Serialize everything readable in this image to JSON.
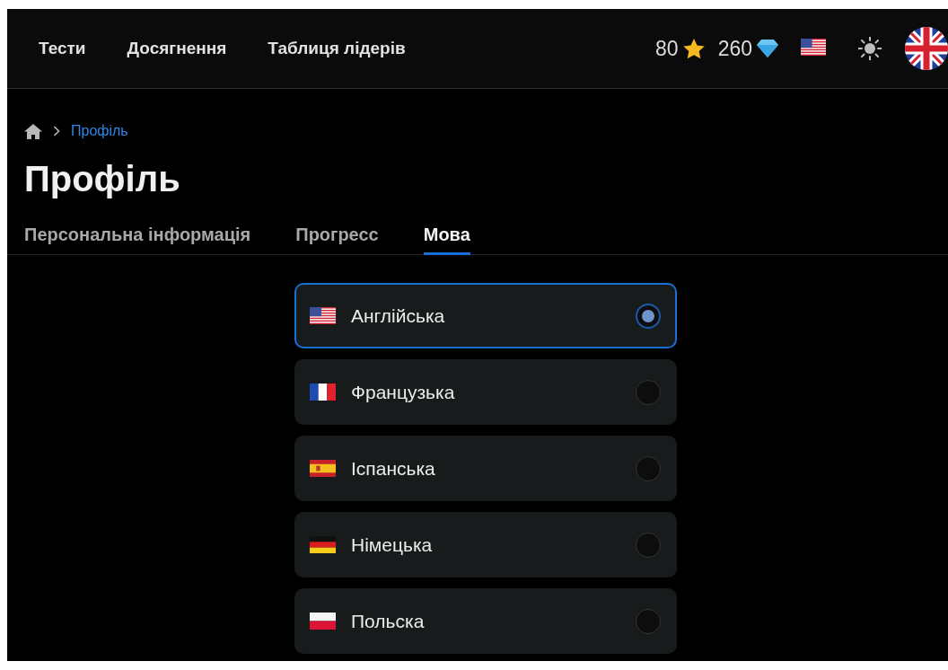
{
  "nav": {
    "links": [
      {
        "label": "Тести"
      },
      {
        "label": "Досягнення"
      },
      {
        "label": "Таблиця лідерів"
      }
    ],
    "stars": "80",
    "gems": "260",
    "language_flag": {
      "kind": "us"
    },
    "avatar": {
      "kind": "gb"
    }
  },
  "breadcrumb": {
    "current": "Профіль"
  },
  "title": "Профіль",
  "tabs": [
    {
      "label": "Персональна інформація",
      "selected": false
    },
    {
      "label": "Прогресс",
      "selected": false
    },
    {
      "label": "Мова",
      "selected": true
    }
  ],
  "languages": [
    {
      "label": "Англійська",
      "kind": "us",
      "selected": true
    },
    {
      "label": "Французька",
      "kind": "fr",
      "selected": false
    },
    {
      "label": "Іспанська",
      "kind": "es",
      "selected": false
    },
    {
      "label": "Німецька",
      "kind": "de",
      "selected": false
    },
    {
      "label": "Польска",
      "kind": "pl",
      "selected": false
    }
  ]
}
